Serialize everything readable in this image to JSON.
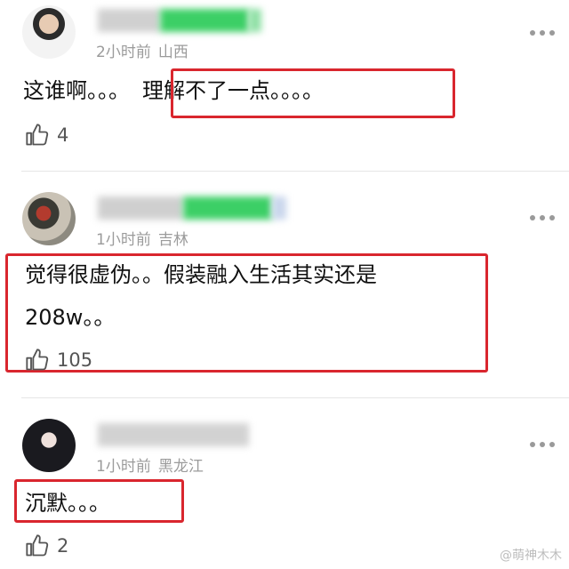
{
  "comments": [
    {
      "time": "2小时前",
      "location": "山西",
      "text_plain": "这谁啊。。。",
      "text_highlighted": "理解不了一点。。。。",
      "likes": "4"
    },
    {
      "time": "1小时前",
      "location": "吉林",
      "text_line1": "觉得很虚伪。。假装融入生活其实还是",
      "text_line2": "208w。。",
      "likes": "105"
    },
    {
      "time": "1小时前",
      "location": "黑龙江",
      "text": "沉默。。。",
      "likes": "2"
    }
  ],
  "icons": {
    "like": "thumbs-up-icon",
    "more": "more-dots-icon"
  },
  "colors": {
    "highlight_border": "#d9262e",
    "meta_text": "#9b9b9b",
    "username_blur_green": "#3ccf66"
  },
  "watermark": "@萌神木木"
}
